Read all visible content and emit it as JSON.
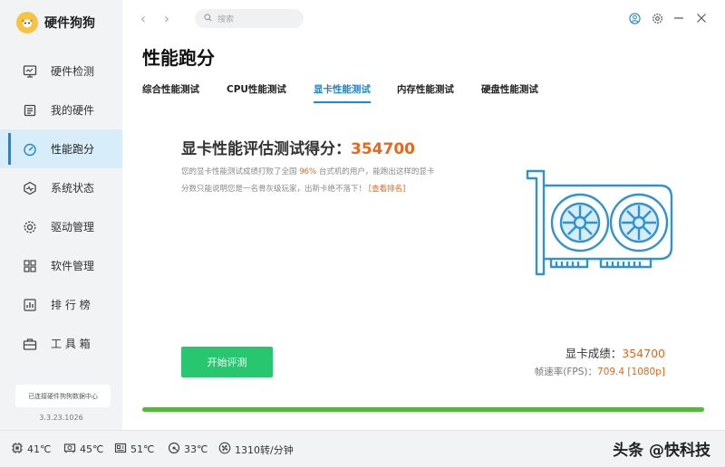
{
  "app": {
    "name": "硬件狗狗",
    "version": "3.3.23.1026",
    "connection_status": "已连接硬件狗狗数据中心"
  },
  "sidebar": {
    "items": [
      {
        "label": "硬件检测",
        "icon": "monitor-icon"
      },
      {
        "label": "我的硬件",
        "icon": "chip-icon"
      },
      {
        "label": "性能跑分",
        "icon": "speedometer-icon",
        "active": true
      },
      {
        "label": "系统状态",
        "icon": "pulse-icon"
      },
      {
        "label": "驱动管理",
        "icon": "gear-icon"
      },
      {
        "label": "软件管理",
        "icon": "grid-icon"
      },
      {
        "label": "排 行 榜",
        "icon": "ranking-icon"
      },
      {
        "label": "工 具 箱",
        "icon": "toolbox-icon"
      }
    ]
  },
  "topbar": {
    "search_placeholder": "搜索"
  },
  "page": {
    "title": "性能跑分",
    "tabs": [
      {
        "label": "综合性能测试",
        "active": false
      },
      {
        "label": "CPU性能测试",
        "active": false
      },
      {
        "label": "显卡性能测试",
        "active": true
      },
      {
        "label": "内存性能测试",
        "active": false
      },
      {
        "label": "硬盘性能测试",
        "active": false
      }
    ]
  },
  "benchmark": {
    "score_label": "显卡性能评估测试得分：",
    "score": "354700",
    "desc_part1": "您的显卡性能测试成绩打败了全国 ",
    "percent": "96%",
    "desc_part2": " 台式机的用户，能跑出这样的显卡",
    "desc_line2": "分数只能说明您是一名骨灰级玩家，出新卡绝不落下！",
    "rank_link": "[查看排名]",
    "start_button": "开始评测",
    "result_label": "显卡成绩：",
    "result_value": "354700",
    "fps_label": "帧速率(FPS)：",
    "fps_value": "709.4 [1080p]",
    "progress": 1.0
  },
  "colors": {
    "accent": "#1b87d6",
    "score": "#e8671d",
    "button": "#28c76f",
    "progress": "#55b83d"
  },
  "status": {
    "cpu_temp": "41℃",
    "gpu_temp": "45℃",
    "board_temp": "51℃",
    "disk_temp": "33℃",
    "fan": "1310转/分钟"
  },
  "watermark": "头条 @快科技"
}
